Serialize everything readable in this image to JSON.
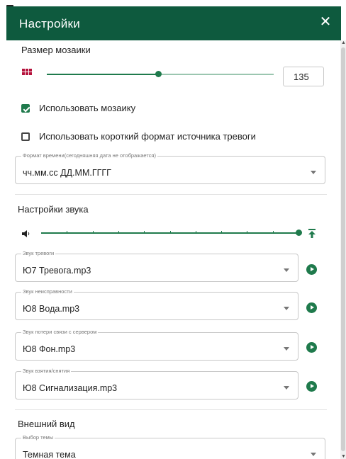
{
  "window": {
    "title": "Настройки"
  },
  "mosaic": {
    "section_title": "Размер мозаики",
    "slider_fraction": 0.49,
    "value": "135",
    "use_mosaic_label": "Использовать мозаику",
    "use_mosaic_checked": true,
    "short_format_label": "Использовать короткий формат источника тревоги",
    "short_format_checked": false
  },
  "time_format": {
    "legend": "Формат времени(сегодняшняя дата не отображается)",
    "value": "чч.мм.сс ДД.ММ.ГГГГ"
  },
  "sound": {
    "section_title": "Настройки звука",
    "volume_fraction": 1.0,
    "alarm": {
      "legend": "Звук тревоги",
      "value": "Ю7 Тревога.mp3"
    },
    "fault": {
      "legend": "Звук неисправности",
      "value": "Ю8 Вода.mp3"
    },
    "connection_loss": {
      "legend": "Звук потери связи с сервером",
      "value": "Ю8 Фон.mp3"
    },
    "arming": {
      "legend": "Звук взятия/снятия",
      "value": "Ю8 Сигнализация.mp3"
    }
  },
  "appearance": {
    "section_title": "Внешний вид",
    "theme_legend": "Выбор темы",
    "theme_value": "Темная тема"
  },
  "colors": {
    "header": "#0e5a3e",
    "accent": "#1f7a4c",
    "mosaic_icon": "#b5123c"
  }
}
